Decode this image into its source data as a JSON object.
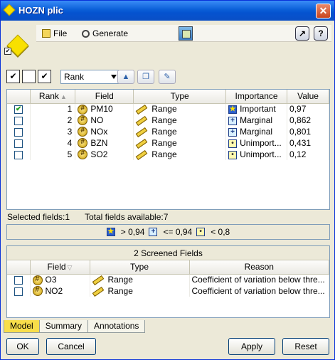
{
  "window": {
    "title": "HOZN plic",
    "close_glyph": "✕"
  },
  "menu": {
    "file": "File",
    "generate": "Generate",
    "file_icon": "file-menu-icon",
    "generate_icon": "generate-icon",
    "view_icon": "chart-view-icon",
    "forward_glyph": "↗",
    "help_glyph": "?"
  },
  "controls": {
    "sort_select": "Rank",
    "check_all_glyph": "✔",
    "check_none_glyph": "",
    "check_toggle_glyph": "✔",
    "up_glyph": "▲",
    "copy_glyph": "❐",
    "clear_glyph": "✎"
  },
  "ranked_table": {
    "columns": [
      "Rank",
      "Field",
      "Type",
      "Importance",
      "Value"
    ],
    "rows": [
      {
        "checked": true,
        "rank": "1",
        "field": "PM10",
        "type": "Range",
        "importance": "Important",
        "importance_icon": "star",
        "value": "0,97"
      },
      {
        "checked": false,
        "rank": "2",
        "field": "NO",
        "type": "Range",
        "importance": "Marginal",
        "importance_icon": "plus",
        "value": "0,862"
      },
      {
        "checked": false,
        "rank": "3",
        "field": "NOx",
        "type": "Range",
        "importance": "Marginal",
        "importance_icon": "plus",
        "value": "0,801"
      },
      {
        "checked": false,
        "rank": "4",
        "field": "BZN",
        "type": "Range",
        "importance": "Unimport...",
        "importance_icon": "dot",
        "value": "0,431"
      },
      {
        "checked": false,
        "rank": "5",
        "field": "SO2",
        "type": "Range",
        "importance": "Unimport...",
        "importance_icon": "dot",
        "value": "0,12"
      }
    ]
  },
  "status": {
    "selected": "Selected fields:1",
    "total": "Total fields available:7"
  },
  "legend": {
    "important": "> 0,94",
    "marginal": "<= 0,94",
    "unimportant": "< 0,8"
  },
  "screened": {
    "title": "2 Screened Fields",
    "columns": [
      "Field",
      "Type",
      "Reason"
    ],
    "rows": [
      {
        "checked": false,
        "field": "O3",
        "type": "Range",
        "reason": "Coefficient of variation below thre..."
      },
      {
        "checked": false,
        "field": "NO2",
        "type": "Range",
        "reason": "Coefficient of variation below thre..."
      }
    ]
  },
  "tabs": [
    "Model",
    "Summary",
    "Annotations"
  ],
  "buttons": {
    "ok": "OK",
    "cancel": "Cancel",
    "apply": "Apply",
    "reset": "Reset"
  },
  "colors": {
    "active_tab": "#f8de4a",
    "titlebar": "#0a5fd8"
  }
}
